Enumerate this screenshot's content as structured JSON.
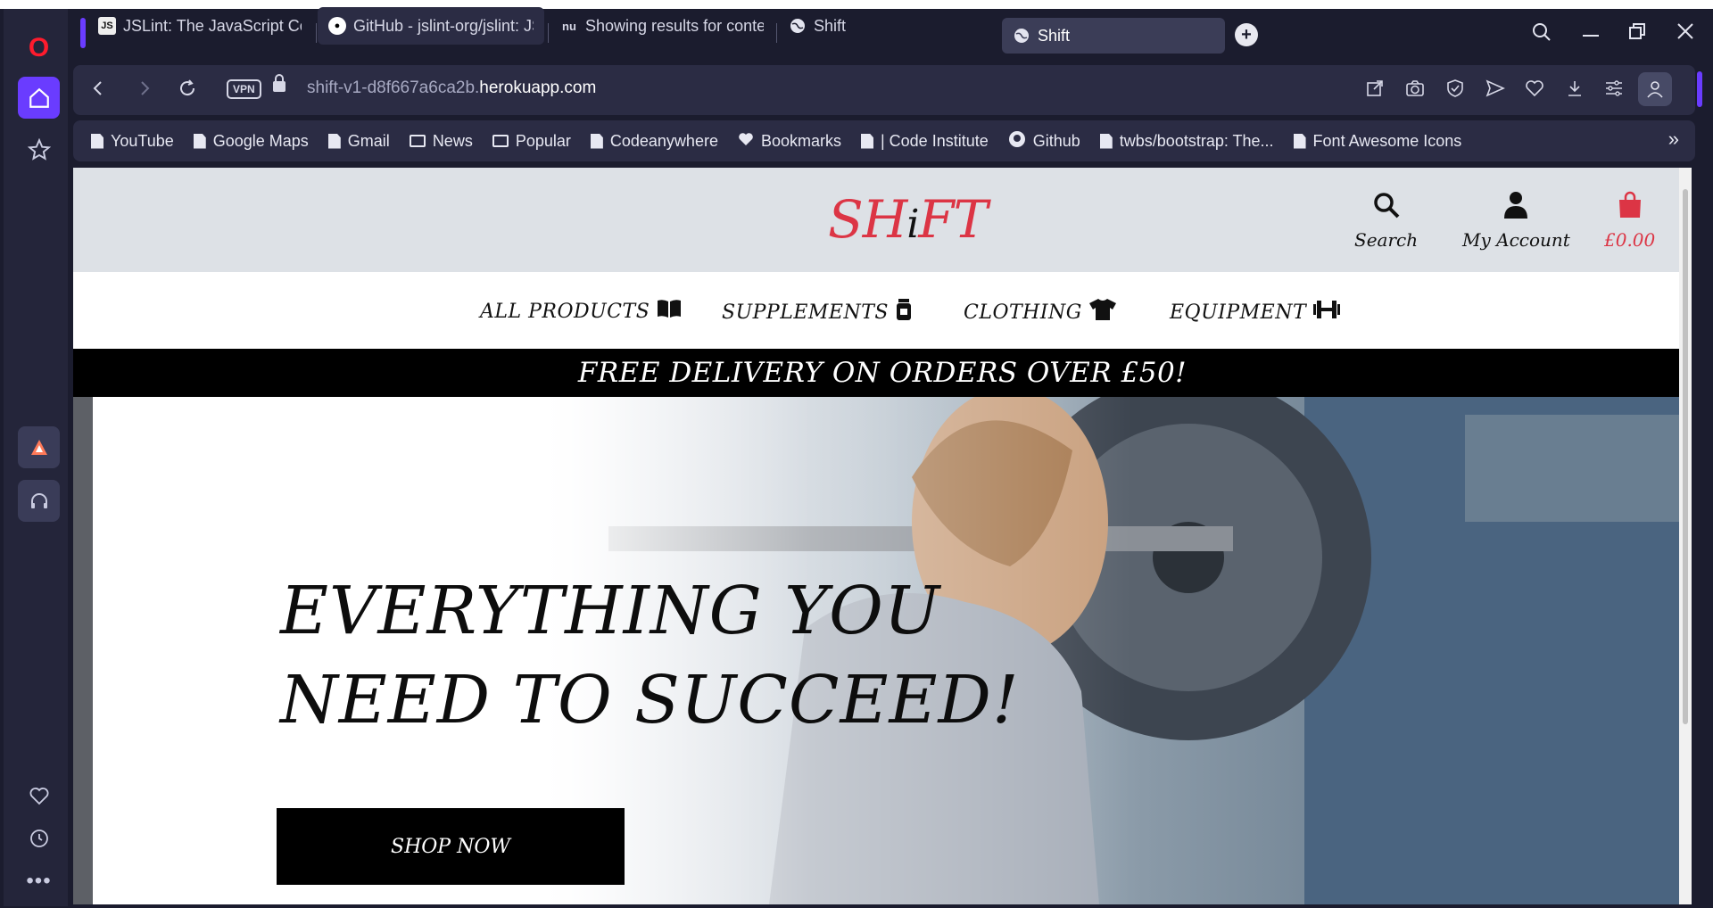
{
  "browser": {
    "tabs": [
      {
        "label": "JSLint: The JavaScript Code Quality Tool",
        "icon": "jslint-icon"
      },
      {
        "label": "GitHub - jslint-org/jslint: JS",
        "icon": "github-icon"
      },
      {
        "label": "Showing results for contents",
        "icon": "nu-icon"
      },
      {
        "label": "Shift",
        "icon": "globe-icon"
      },
      {
        "label": "Shift",
        "icon": "globe-icon",
        "active": true
      }
    ],
    "vpn_label": "VPN",
    "url_prefix": "shift-v1-d8f667a6ca2b.",
    "url_domain": "herokuapp.com",
    "bookmarks": [
      {
        "label": "YouTube",
        "type": "page"
      },
      {
        "label": "Google Maps",
        "type": "page"
      },
      {
        "label": "Gmail",
        "type": "page"
      },
      {
        "label": "News",
        "type": "folder"
      },
      {
        "label": "Popular",
        "type": "folder"
      },
      {
        "label": "Codeanywhere",
        "type": "page"
      },
      {
        "label": "Bookmarks",
        "type": "heart"
      },
      {
        "label": "| Code Institute",
        "type": "page"
      },
      {
        "label": "Github",
        "type": "github"
      },
      {
        "label": "twbs/bootstrap: The...",
        "type": "page"
      },
      {
        "label": "Font Awesome Icons",
        "type": "page"
      }
    ],
    "bookmarks_more": "»"
  },
  "site": {
    "logo_left": "SH",
    "logo_i": "i",
    "logo_right": "FT",
    "search_label": "Search",
    "account_label": "My Account",
    "bag_total": "£0.00",
    "nav": {
      "all_products": "ALL PRODUCTS",
      "supplements": "SUPPLEMENTS",
      "clothing": "CLOTHING",
      "equipment": "EQUIPMENT"
    },
    "banner": "FREE DELIVERY ON ORDERS OVER £50!",
    "hero_line1": "EVERYTHING YOU",
    "hero_line2": "NEED TO SUCCEED!",
    "shop_now": "SHOP NOW"
  },
  "colors": {
    "accent": "#6a3cff",
    "brand_red": "#dc3545",
    "header_bg": "#dde1e6",
    "browser_bg": "#1b1c2e"
  }
}
